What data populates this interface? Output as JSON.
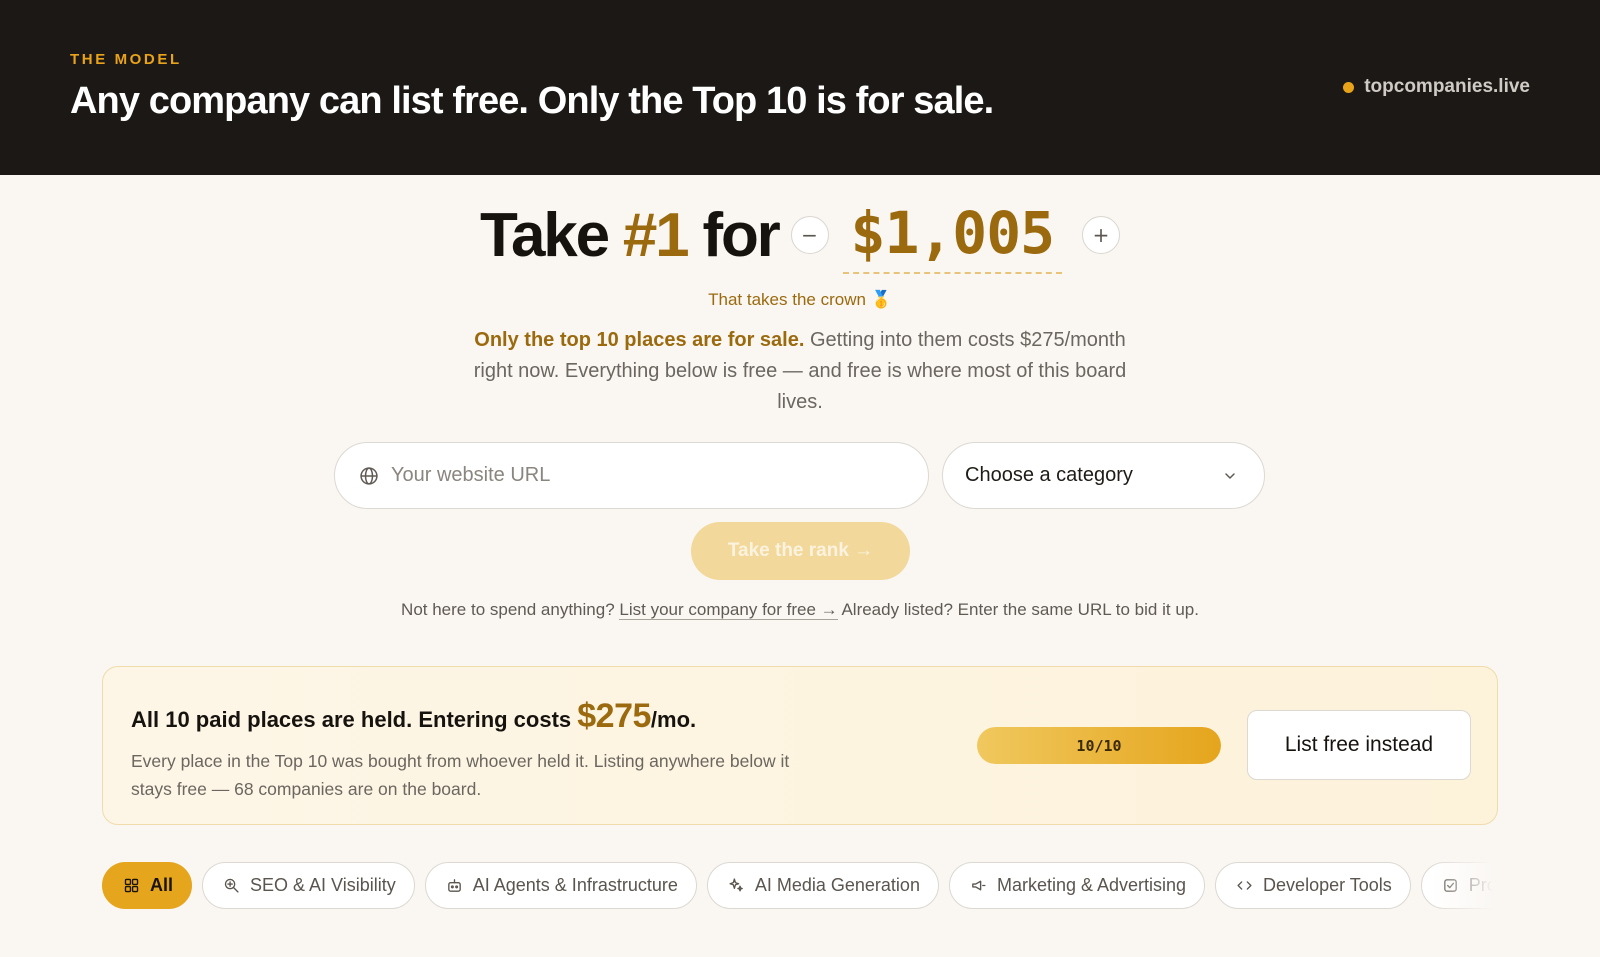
{
  "header": {
    "eyebrow": "THE MODEL",
    "headline": "Any company can list free. Only the Top 10 is for sale.",
    "site": "topcompanies.live"
  },
  "hero": {
    "take": "Take",
    "rank": "#1",
    "for": "for",
    "price": "$1,005",
    "minus_label": "−",
    "plus_label": "+",
    "subtitle": "That takes the crown 🥇",
    "lead_bold": "Only the top 10 places are for sale.",
    "lead_rest": " Getting into them costs $275/month right now. Everything below is free — and free is where most of this board lives."
  },
  "form": {
    "url_placeholder": "Your website URL",
    "url_value": "",
    "category_value": "Choose a category",
    "submit_label": "Take the rank →"
  },
  "note": {
    "lead": "Not here to spend anything?",
    "link": "List your company for free →",
    "tail": "Already listed? Enter the same URL to bid it up."
  },
  "banner": {
    "title_pre": "All 10 paid places are held. Entering costs ",
    "amount": "$275",
    "title_post": "/mo.",
    "desc": "Every place in the Top 10 was bought from whoever held it. Listing anywhere below it stays free — 68 companies are on the board.",
    "progress_label": "10/10",
    "progress_fraction": 1.0,
    "cta": "List free instead"
  },
  "categories": [
    {
      "label": "All",
      "icon": "grid-icon",
      "active": true
    },
    {
      "label": "SEO & AI Visibility",
      "icon": "search-icon",
      "active": false
    },
    {
      "label": "AI Agents & Infrastructure",
      "icon": "robot-icon",
      "active": false
    },
    {
      "label": "AI Media Generation",
      "icon": "sparkles-icon",
      "active": false
    },
    {
      "label": "Marketing & Advertising",
      "icon": "megaphone-icon",
      "active": false
    },
    {
      "label": "Developer Tools",
      "icon": "code-icon",
      "active": false
    },
    {
      "label": "Prod",
      "icon": "product-icon",
      "active": false
    }
  ],
  "colors": {
    "accent": "#e5a51d",
    "accent_dark": "#9b6a0f",
    "header_bg": "#1b1815",
    "page_bg": "#faf7f3"
  }
}
